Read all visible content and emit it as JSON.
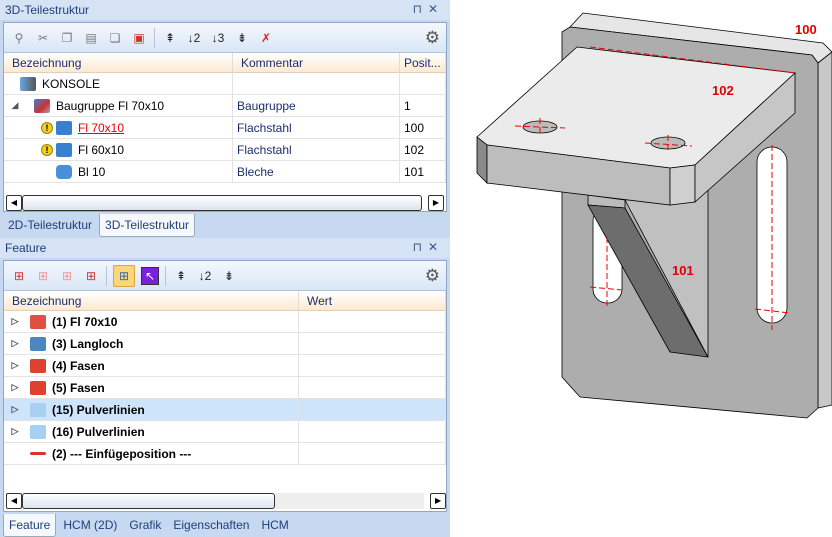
{
  "top_panel": {
    "title": "3D-Teilestruktur",
    "pin": "⊓",
    "close": "✕",
    "columns": [
      "Bezeichnung",
      "Kommentar",
      "Posit..."
    ],
    "rows": [
      {
        "name": "KONSOLE",
        "comment": "",
        "pos": "",
        "icon": "assembly-root-icon"
      },
      {
        "name": "Baugruppe Fl 70x10",
        "comment": "Baugruppe",
        "pos": "1",
        "icon": "subassembly-icon"
      },
      {
        "name": "Fl 70x10",
        "comment": "Flachstahl",
        "pos": "100",
        "icon": "steel-profile-icon"
      },
      {
        "name": "Fl 60x10",
        "comment": "Flachstahl",
        "pos": "102",
        "icon": "steel-profile-icon"
      },
      {
        "name": "Bl 10",
        "comment": "Bleche",
        "pos": "101",
        "icon": "sheet-icon"
      }
    ],
    "tabs": [
      "2D-Teilestruktur",
      "3D-Teilestruktur"
    ]
  },
  "feature_panel": {
    "title": "Feature",
    "pin": "⊓",
    "close": "✕",
    "columns": [
      "Bezeichnung",
      "Wert"
    ],
    "rows": [
      {
        "name": "(1) Fl 70x10",
        "color": "#e05040"
      },
      {
        "name": "(3)  Langloch",
        "color": "#4a86c0"
      },
      {
        "name": "(4) Fasen",
        "color": "#e04030"
      },
      {
        "name": "(5) Fasen",
        "color": "#e04030"
      },
      {
        "name": "(15) Pulverlinien",
        "color": "#a8d0f0"
      },
      {
        "name": "(16) Pulverlinien",
        "color": "#a8d0f0"
      },
      {
        "name": "(2) --- Einfügeposition ---",
        "color": "#e03030"
      }
    ],
    "tabs": [
      "Feature",
      "HCM (2D)",
      "Grafik",
      "Eigenschaften",
      "HCM"
    ]
  },
  "viewport": {
    "labels": [
      "100",
      "102",
      "101"
    ],
    "label_color": "#e00000"
  }
}
